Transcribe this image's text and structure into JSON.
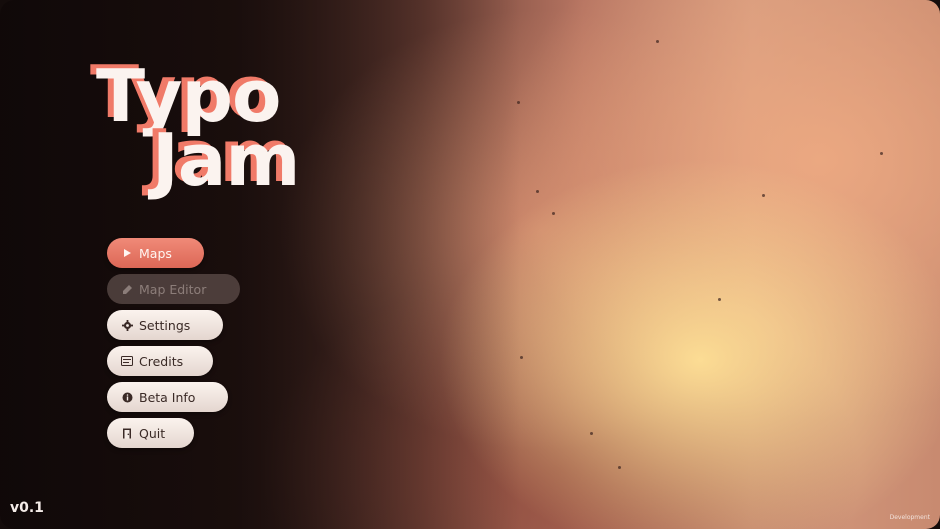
{
  "logo": {
    "line1": "Typo",
    "line2": "Jam",
    "text_color": "#fbf3ef",
    "accent_color": "#f07a68"
  },
  "menu": {
    "items": [
      {
        "label": "Maps",
        "icon": "play-icon",
        "state": "active"
      },
      {
        "label": "Map Editor",
        "icon": "editor-icon",
        "state": "disabled"
      },
      {
        "label": "Settings",
        "icon": "gear-icon",
        "state": "normal"
      },
      {
        "label": "Credits",
        "icon": "credits-icon",
        "state": "normal"
      },
      {
        "label": "Beta Info",
        "icon": "info-icon",
        "state": "normal"
      },
      {
        "label": "Quit",
        "icon": "door-icon",
        "state": "normal"
      }
    ]
  },
  "version": "v0.1",
  "watermark": "Development",
  "colors": {
    "accent": "#e8725f",
    "button_bg": "#f4ebe6",
    "button_text": "#3a2a26"
  }
}
